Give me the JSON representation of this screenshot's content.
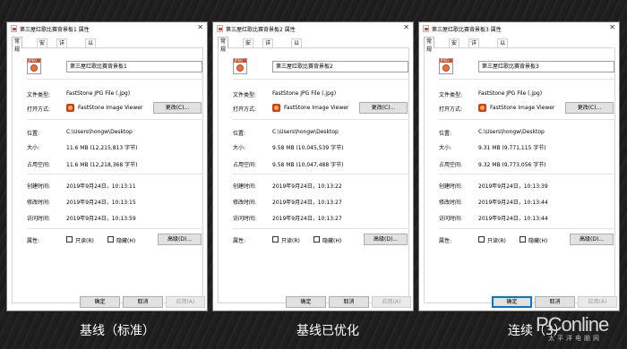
{
  "dialogs": [
    {
      "title": "第三屋红歌比赛背景板1 属性",
      "filename": "第三屋红歌比赛背景板1",
      "size": "11.6 MB (12,215,813 字节)",
      "size_on_disk": "11.6 MB (12,218,368 字节)",
      "created": "2019年9月24日，10:13:11",
      "modified": "2019年9月24日，10:13:15",
      "accessed": "2019年9月24日，10:13:59",
      "ok_focused": false
    },
    {
      "title": "第三屋红歌比赛背景板2 属性",
      "filename": "第三屋红歌比赛背景板2",
      "size": "9.58 MB (10,045,539 字节)",
      "size_on_disk": "9.58 MB (10,047,488 字节)",
      "created": "2019年9月24日，10:13:22",
      "modified": "2019年9月24日，10:13:27",
      "accessed": "2019年9月24日，10:13:27",
      "ok_focused": false
    },
    {
      "title": "第三屋红歌比赛背景板3 属性",
      "filename": "第三屋红歌比赛背景板3",
      "size": "9.31 MB (9,771,115 字节)",
      "size_on_disk": "9.32 MB (9,773,056 字节)",
      "created": "2019年9月24日，10:13:39",
      "modified": "2019年9月24日，10:13:44",
      "accessed": "2019年9月24日，10:13:44",
      "ok_focused": true
    }
  ],
  "common": {
    "tabs": [
      "常规",
      "安全",
      "详细信息",
      "以前的版本"
    ],
    "file_type_label": "文件类型:",
    "file_type_value": "FastStone JPG File (.jpg)",
    "opens_with_label": "打开方式:",
    "opens_with_value": "FastStone Image Viewer",
    "change_button": "更改(C)...",
    "location_label": "位置:",
    "location_value": "C:\\Users\\hongw\\Desktop",
    "size_label": "大小:",
    "size_on_disk_label": "占用空间:",
    "created_label": "创建时间:",
    "modified_label": "修改时间:",
    "accessed_label": "访问时间:",
    "attributes_label": "属性:",
    "readonly_label": "只读(R)",
    "hidden_label": "隐藏(H)",
    "advanced_button": "高级(D)...",
    "ok_button": "确定",
    "cancel_button": "取消",
    "apply_button": "应用(A)",
    "file_icon_letters": "JPEG"
  },
  "captions": [
    "基线（标准）",
    "基线已优化",
    "连续（3）"
  ],
  "watermark": {
    "brand": "PConline",
    "sub": "太平洋电脑网"
  },
  "colors": {
    "accent_focus": "#0078d7",
    "icon_red": "#d9462d"
  }
}
